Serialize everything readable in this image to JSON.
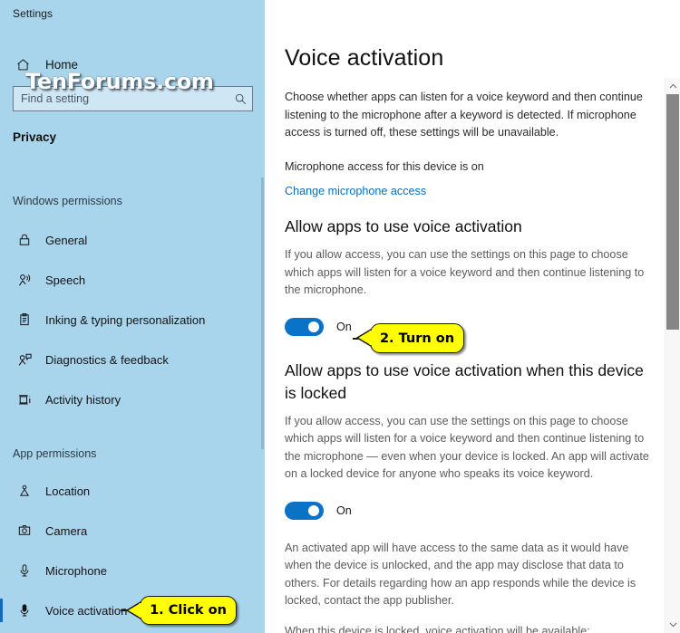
{
  "window": {
    "app_title": "Settings",
    "controls": [
      {
        "name": "minimize",
        "glyph": "─"
      },
      {
        "name": "maximize",
        "glyph": "□"
      },
      {
        "name": "close",
        "glyph": "✕"
      }
    ]
  },
  "watermark": {
    "text": "TenForums.com"
  },
  "sidebar": {
    "home_label": "Home",
    "search": {
      "placeholder": "Find a setting",
      "value": "",
      "icon": "search-icon"
    },
    "category_title": "Privacy",
    "groups": [
      {
        "title": "Windows permissions",
        "items": [
          {
            "label": "General",
            "icon": "lock-icon",
            "selected": false
          },
          {
            "label": "Speech",
            "icon": "speech-person-icon",
            "selected": false
          },
          {
            "label": "Inking & typing personalization",
            "icon": "clipboard-icon",
            "selected": false
          },
          {
            "label": "Diagnostics & feedback",
            "icon": "person-feedback-icon",
            "selected": false
          },
          {
            "label": "Activity history",
            "icon": "activity-history-icon",
            "selected": false
          }
        ]
      },
      {
        "title": "App permissions",
        "items": [
          {
            "label": "Location",
            "icon": "location-pin-icon",
            "selected": false
          },
          {
            "label": "Camera",
            "icon": "camera-icon",
            "selected": false
          },
          {
            "label": "Microphone",
            "icon": "microphone-icon",
            "selected": false
          },
          {
            "label": "Voice activation",
            "icon": "microphone-icon",
            "selected": true
          }
        ]
      }
    ]
  },
  "main": {
    "page_title": "Voice activation",
    "intro": "Choose whether apps can listen for a voice keyword and then continue listening to the microphone after a keyword is detected. If microphone access is turned off, these settings will be unavailable.",
    "mic_status": "Microphone access for this device is on",
    "change_link": "Change microphone access",
    "sections": [
      {
        "heading": "Allow apps to use voice activation",
        "description": "If you allow access, you can use the settings on this page to choose which apps will listen for a voice keyword and then continue listening to the microphone.",
        "toggle_state": "On"
      },
      {
        "heading": "Allow apps to use voice activation when this device is locked",
        "description": "If you allow access, you can use the settings on this page to choose which apps will listen for a voice keyword and then continue listening to the microphone — even when your device is locked. An app will activate on a locked device for anyone who speaks its voice keyword.",
        "toggle_state": "On"
      }
    ],
    "footnote": "An activated app will have access to the same data as it would have when the device is unlocked, and the app may disclose that data to others. For details regarding how an app responds while the device is locked, contact the app publisher.",
    "availability_note": "When this device is locked, voice activation will be available:"
  },
  "callouts": [
    {
      "text": "1. Click on"
    },
    {
      "text": "2. Turn on"
    }
  ],
  "colors": {
    "sidebar_bg": "#a9d5ec",
    "accent_blue": "#0a72c7",
    "link_blue": "#0a6ebd",
    "callout_yellow": "#ffff00",
    "selection_bar": "#0f6cbd"
  }
}
